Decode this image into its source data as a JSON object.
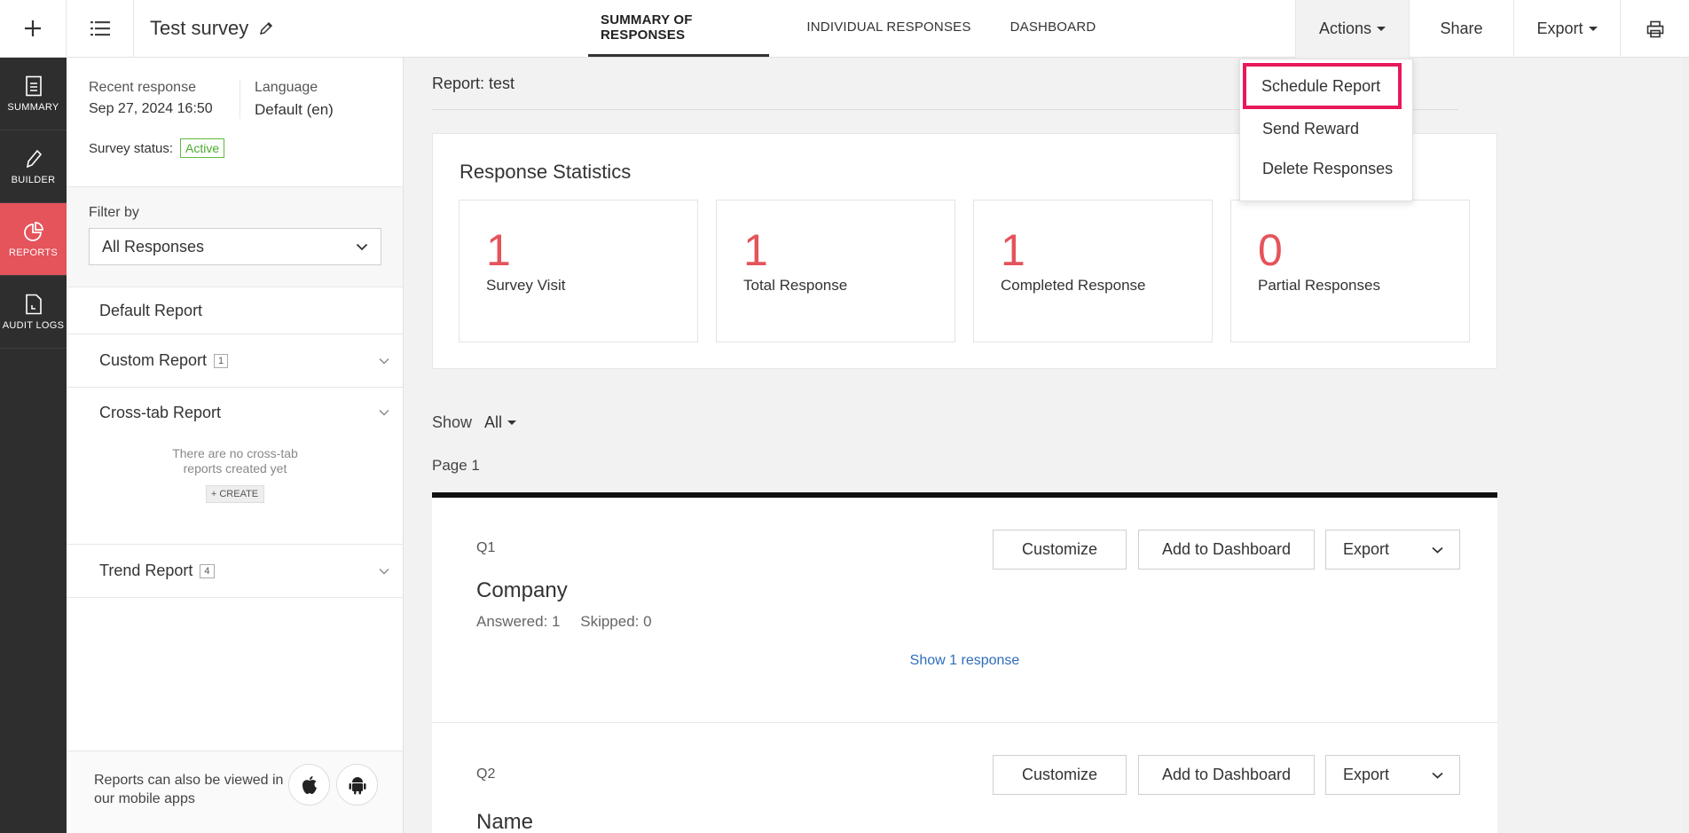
{
  "topbar": {
    "survey_title": "Test survey",
    "tabs": [
      {
        "label": "SUMMARY OF RESPONSES",
        "active": true
      },
      {
        "label": "INDIVIDUAL RESPONSES",
        "active": false
      },
      {
        "label": "DASHBOARD",
        "active": false
      }
    ],
    "actions_label": "Actions",
    "share_label": "Share",
    "export_label": "Export"
  },
  "leftnav": {
    "items": [
      {
        "label": "SUMMARY",
        "icon": "document-icon"
      },
      {
        "label": "BUILDER",
        "icon": "pencil-icon"
      },
      {
        "label": "REPORTS",
        "icon": "pie-chart-icon",
        "active": true
      },
      {
        "label": "AUDIT LOGS",
        "icon": "log-file-icon"
      }
    ]
  },
  "sidepanel": {
    "recent_response_label": "Recent response",
    "recent_response_value": "Sep 27, 2024 16:50",
    "language_label": "Language",
    "language_value": "Default (en)",
    "status_label": "Survey status:",
    "status_value": "Active",
    "filter_label": "Filter by",
    "filter_value": "All Responses",
    "reports": [
      {
        "label": "Default Report"
      },
      {
        "label": "Custom Report",
        "count": "1"
      },
      {
        "label": "Cross-tab Report"
      },
      {
        "label": "Trend Report",
        "count": "4"
      }
    ],
    "crosstab_empty": "There are no cross-tab reports created yet",
    "create_label": "+ CREATE",
    "footer_text": "Reports can also be viewed in our mobile apps"
  },
  "main": {
    "report_title": "Report: test",
    "stats_heading": "Response Statistics",
    "stats": [
      {
        "value": "1",
        "label": "Survey Visit"
      },
      {
        "value": "1",
        "label": "Total Response"
      },
      {
        "value": "1",
        "label": "Completed Response"
      },
      {
        "value": "0",
        "label": "Partial Responses"
      }
    ],
    "show_label": "Show",
    "show_value": "All",
    "page_label": "Page 1",
    "questions": [
      {
        "num": "Q1",
        "title": "Company",
        "answered": "Answered: 1",
        "skipped": "Skipped: 0",
        "show_response": "Show 1 response"
      },
      {
        "num": "Q2",
        "title": "Name"
      }
    ],
    "btn_customize": "Customize",
    "btn_add_dashboard": "Add to Dashboard",
    "btn_export": "Export"
  },
  "actions_menu": {
    "items": [
      "Schedule Report",
      "Send Reward",
      "Delete Responses"
    ]
  },
  "colors": {
    "accent_red": "#e5535b",
    "highlight_pink": "#e8195a",
    "active_green": "#4aab2a",
    "link_blue": "#2e6dbd"
  }
}
